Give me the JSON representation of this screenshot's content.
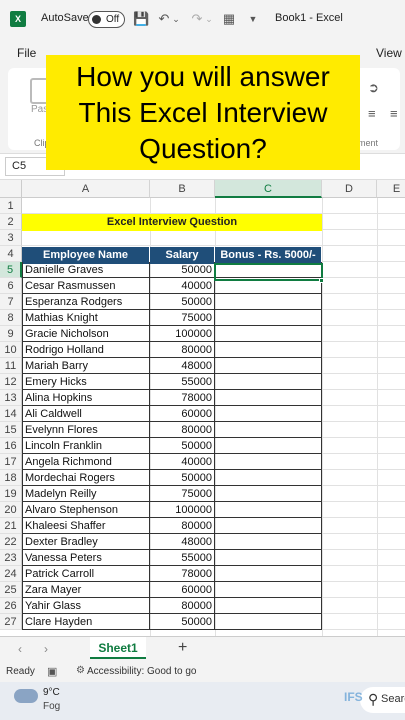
{
  "window": {
    "autosave_label": "AutoSave",
    "autosave_state": "Off",
    "doc_title": "Book1  -  Excel"
  },
  "menu": {
    "file": "File",
    "view": "View"
  },
  "ribbon": {
    "paste": "Paste",
    "clipboard": "Clipbo",
    "alignment": "nment"
  },
  "overlay": {
    "text": "How you will answer\nThis Excel Interview\nQuestion?"
  },
  "formula_bar": {
    "name_box": "C5"
  },
  "columns": [
    "A",
    "B",
    "C",
    "D",
    "E"
  ],
  "rows": [
    "1",
    "2",
    "3",
    "4",
    "5",
    "6",
    "7",
    "8",
    "9",
    "10",
    "11",
    "12",
    "13",
    "14",
    "15",
    "16",
    "17",
    "18",
    "19",
    "20",
    "21",
    "22",
    "23",
    "24",
    "25",
    "26",
    "27"
  ],
  "sheet": {
    "banner": "Excel Interview Question",
    "headers": {
      "name": "Employee Name",
      "salary": "Salary",
      "bonus": "Bonus - Rs. 5000/-"
    },
    "employees": [
      {
        "name": "Danielle Graves",
        "salary": "50000"
      },
      {
        "name": "Cesar Rasmussen",
        "salary": "40000"
      },
      {
        "name": "Esperanza Rodgers",
        "salary": "50000"
      },
      {
        "name": "Mathias Knight",
        "salary": "75000"
      },
      {
        "name": "Gracie Nicholson",
        "salary": "100000"
      },
      {
        "name": "Rodrigo Holland",
        "salary": "80000"
      },
      {
        "name": "Mariah Barry",
        "salary": "48000"
      },
      {
        "name": "Emery Hicks",
        "salary": "55000"
      },
      {
        "name": "Alina Hopkins",
        "salary": "78000"
      },
      {
        "name": "Ali Caldwell",
        "salary": "60000"
      },
      {
        "name": "Evelynn Flores",
        "salary": "80000"
      },
      {
        "name": "Lincoln Franklin",
        "salary": "50000"
      },
      {
        "name": "Angela Richmond",
        "salary": "40000"
      },
      {
        "name": "Mordechai Rogers",
        "salary": "50000"
      },
      {
        "name": "Madelyn Reilly",
        "salary": "75000"
      },
      {
        "name": "Alvaro Stephenson",
        "salary": "100000"
      },
      {
        "name": "Khaleesi Shaffer",
        "salary": "80000"
      },
      {
        "name": "Dexter Bradley",
        "salary": "48000"
      },
      {
        "name": "Vanessa Peters",
        "salary": "55000"
      },
      {
        "name": "Patrick Carroll",
        "salary": "78000"
      },
      {
        "name": "Zara Mayer",
        "salary": "60000"
      },
      {
        "name": "Yahir Glass",
        "salary": "80000"
      },
      {
        "name": "Clare Hayden",
        "salary": "50000"
      }
    ]
  },
  "tabs": {
    "sheet1": "Sheet1",
    "add": "+"
  },
  "status": {
    "ready": "Ready",
    "accessibility": "Accessibility: Good to go"
  },
  "taskbar": {
    "temp": "9°C",
    "weather": "Fog",
    "search": "Search",
    "watermark": "IFS"
  }
}
